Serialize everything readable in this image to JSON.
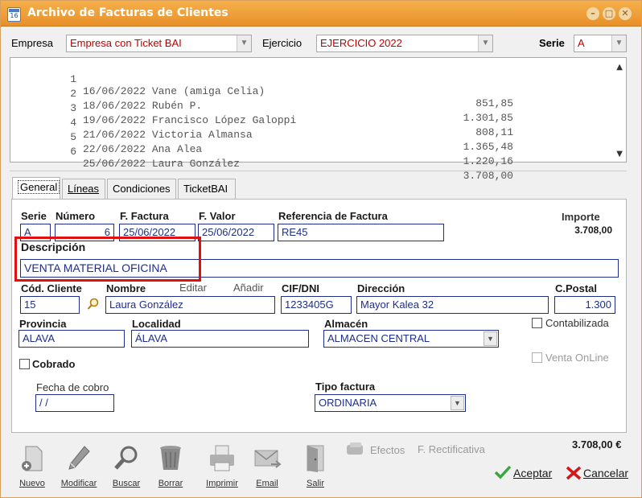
{
  "window": {
    "title": "Archivo de Facturas de Clientes",
    "icon_label": "16",
    "controls": {
      "minimize": "–",
      "maximize": "□",
      "close": "✕"
    }
  },
  "header": {
    "empresa_label": "Empresa",
    "empresa_value": "Empresa con Ticket BAI",
    "ejercicio_label": "Ejercicio",
    "ejercicio_value": "EJERCICIO 2022",
    "serie_label": "Serie",
    "serie_value": "A"
  },
  "invoice_list": [
    {
      "num": "1",
      "text": "16/06/2022 Vane (amiga Celia)",
      "amount": "851,85"
    },
    {
      "num": "2",
      "text": "18/06/2022 Rubén P.",
      "amount": "1.301,85"
    },
    {
      "num": "3",
      "text": "19/06/2022 Francisco López Galoppi",
      "amount": "808,11"
    },
    {
      "num": "4",
      "text": "21/06/2022 Victoria Almansa",
      "amount": "1.365,48"
    },
    {
      "num": "5",
      "text": "22/06/2022 Ana Alea",
      "amount": "1.220,16"
    },
    {
      "num": "6",
      "text": "25/06/2022 Laura González",
      "amount": "3.708,00"
    }
  ],
  "tabs": [
    {
      "label": "General"
    },
    {
      "label": "Líneas"
    },
    {
      "label": "Condiciones"
    },
    {
      "label": "TicketBAI"
    }
  ],
  "general": {
    "serie_label": "Serie",
    "serie_value": "A",
    "numero_label": "Número",
    "numero_value": "6",
    "f_factura_label": "F. Factura",
    "f_factura_value": "25/06/2022",
    "f_valor_label": "F. Valor",
    "f_valor_value": "25/06/2022",
    "referencia_label": "Referencia de Factura",
    "referencia_value": "RE45",
    "importe_label": "Importe",
    "importe_value": "3.708,00",
    "descripcion_label": "Descripción",
    "descripcion_value": "VENTA MATERIAL OFICINA",
    "cod_cliente_label": "Cód. Cliente",
    "cod_cliente_value": "15",
    "nombre_label": "Nombre",
    "nombre_value": "Laura González",
    "editar_label": "Editar",
    "anadir_label": "Añadir",
    "cif_label": "CIF/DNI",
    "cif_value": "1233405G",
    "direccion_label": "Dirección",
    "direccion_value": "Mayor Kalea 32",
    "cpostal_label": "C.Postal",
    "cpostal_value": "1.300",
    "provincia_label": "Provincia",
    "provincia_value": "ALAVA",
    "localidad_label": "Localidad",
    "localidad_value": "ÁLAVA",
    "almacen_label": "Almacén",
    "almacen_value": "ALMACEN CENTRAL",
    "contabilizada_label": "Contabilizada",
    "venta_online_label": "Venta OnLine",
    "cobrado_label": "Cobrado",
    "fecha_cobro_label": "Fecha de cobro",
    "fecha_cobro_value": " /  /",
    "tipo_factura_label": "Tipo factura",
    "tipo_factura_value": "ORDINARIA"
  },
  "footer": {
    "total": "3.708,00 €",
    "efectos_label": "Efectos",
    "rectificativa_label": "F. Rectificativa",
    "toolbar": [
      {
        "label": "Nuevo",
        "icon": "new-document-icon"
      },
      {
        "label": "Modificar",
        "icon": "pen-icon"
      },
      {
        "label": "Buscar",
        "icon": "magnifier-icon"
      },
      {
        "label": "Borrar",
        "icon": "trash-icon"
      },
      {
        "label": "Imprimir",
        "icon": "printer-icon"
      },
      {
        "label": "Email",
        "icon": "envelope-icon"
      },
      {
        "label": "Salir",
        "icon": "door-icon"
      }
    ],
    "aceptar_label": "Aceptar",
    "cancelar_label": "Cancelar"
  },
  "colors": {
    "titlebar": "#f0a03c",
    "field_text": "#1e2e8a",
    "highlight": "#e01010",
    "combo_text": "#c00000"
  }
}
